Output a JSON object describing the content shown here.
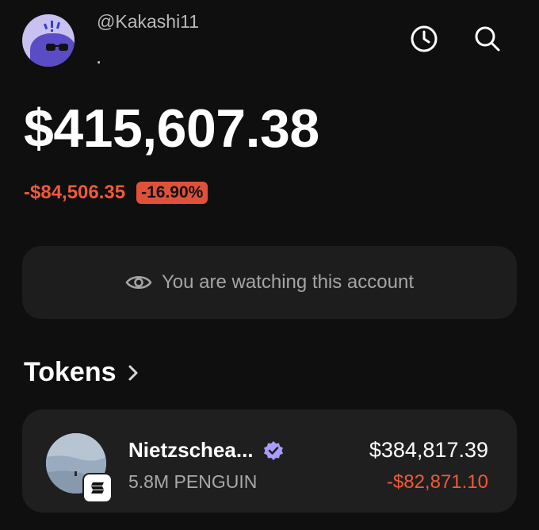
{
  "account": {
    "handle": "@Kakashi11",
    "subtitle": "."
  },
  "header": {
    "icons": [
      "history-icon",
      "search-icon"
    ]
  },
  "portfolio": {
    "balance": "$415,607.38",
    "change_value": "-$84,506.35",
    "change_percent": "-16.90%"
  },
  "watch_banner": {
    "text": "You are watching this account"
  },
  "tokens_section": {
    "title": "Tokens",
    "items": [
      {
        "name": "Nietzschea...",
        "amount": "5.8M PENGUIN",
        "value": "$384,817.39",
        "change": "-$82,871.10"
      }
    ]
  },
  "colors": {
    "background": "#0f0f0f",
    "negative": "#ef5a3a",
    "card": "#1f1f1f",
    "verified": "#a99cff"
  }
}
